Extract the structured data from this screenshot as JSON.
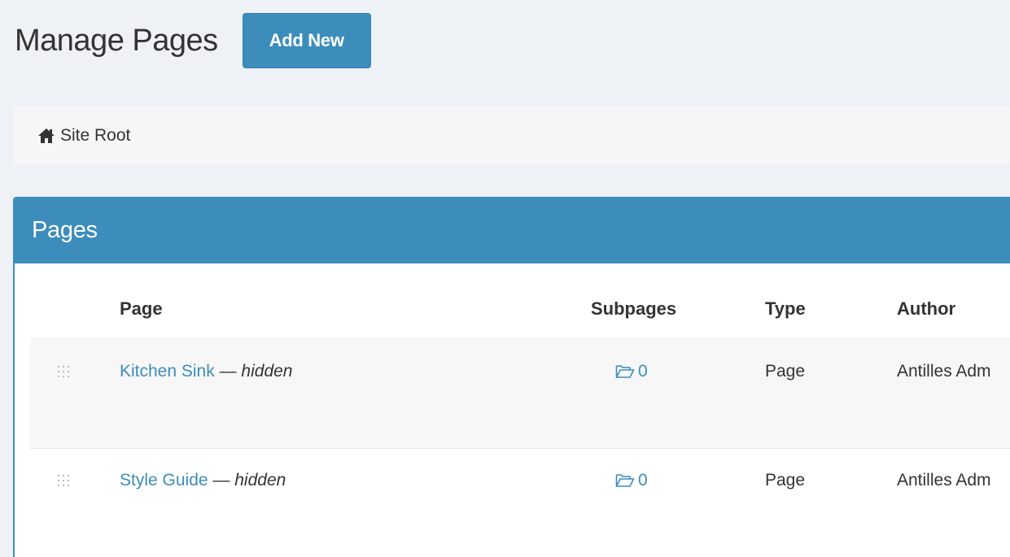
{
  "header": {
    "title": "Manage Pages",
    "add_new_label": "Add New"
  },
  "breadcrumb": {
    "icon": "home-icon",
    "label": "Site Root"
  },
  "panel": {
    "title": "Pages"
  },
  "table": {
    "columns": [
      "Page",
      "Subpages",
      "Type",
      "Author"
    ],
    "rows": [
      {
        "page": "Kitchen Sink",
        "separator": "—",
        "status": "hidden",
        "subpages": "0",
        "type": "Page",
        "author": "Antilles Adm"
      },
      {
        "page": "Style Guide",
        "separator": "—",
        "status": "hidden",
        "subpages": "0",
        "type": "Page",
        "author": "Antilles Adm"
      }
    ]
  },
  "colors": {
    "accent": "#3c8dbc",
    "background": "#eef1f6",
    "breadcrumb_bg": "#f6f6f6",
    "text": "#333333"
  }
}
